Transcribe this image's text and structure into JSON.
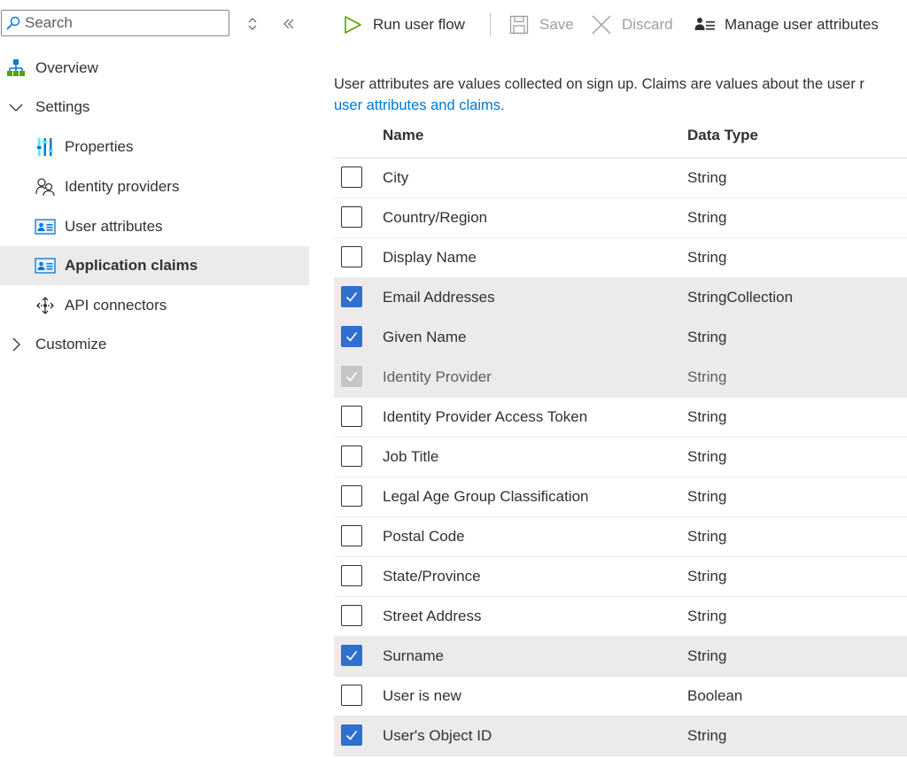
{
  "sidebar": {
    "search": {
      "placeholder": "Search",
      "value": ""
    },
    "items": [
      {
        "label": "Overview",
        "icon": "overview-icon"
      },
      {
        "label": "Settings",
        "icon": "chevron-down-icon"
      },
      {
        "label": "Properties",
        "icon": "properties-icon"
      },
      {
        "label": "Identity providers",
        "icon": "identity-providers-icon"
      },
      {
        "label": "User attributes",
        "icon": "user-attributes-icon"
      },
      {
        "label": "Application claims",
        "icon": "application-claims-icon"
      },
      {
        "label": "API connectors",
        "icon": "api-connectors-icon"
      },
      {
        "label": "Customize",
        "icon": "chevron-right-icon"
      }
    ],
    "selected": "Application claims"
  },
  "toolbar": {
    "run_label": "Run user flow",
    "save_label": "Save",
    "discard_label": "Discard",
    "manage_label": "Manage user attributes"
  },
  "description": {
    "text": "User attributes are values collected on sign up. Claims are values about the user r",
    "link": "user attributes and claims."
  },
  "table": {
    "headers": {
      "name": "Name",
      "type": "Data Type"
    },
    "rows": [
      {
        "name": "City",
        "type": "String",
        "checked": false,
        "disabled": false
      },
      {
        "name": "Country/Region",
        "type": "String",
        "checked": false,
        "disabled": false
      },
      {
        "name": "Display Name",
        "type": "String",
        "checked": false,
        "disabled": false
      },
      {
        "name": "Email Addresses",
        "type": "StringCollection",
        "checked": true,
        "disabled": false
      },
      {
        "name": "Given Name",
        "type": "String",
        "checked": true,
        "disabled": false
      },
      {
        "name": "Identity Provider",
        "type": "String",
        "checked": true,
        "disabled": true
      },
      {
        "name": "Identity Provider Access Token",
        "type": "String",
        "checked": false,
        "disabled": false
      },
      {
        "name": "Job Title",
        "type": "String",
        "checked": false,
        "disabled": false
      },
      {
        "name": "Legal Age Group Classification",
        "type": "String",
        "checked": false,
        "disabled": false
      },
      {
        "name": "Postal Code",
        "type": "String",
        "checked": false,
        "disabled": false
      },
      {
        "name": "State/Province",
        "type": "String",
        "checked": false,
        "disabled": false
      },
      {
        "name": "Street Address",
        "type": "String",
        "checked": false,
        "disabled": false
      },
      {
        "name": "Surname",
        "type": "String",
        "checked": true,
        "disabled": false
      },
      {
        "name": "User is new",
        "type": "Boolean",
        "checked": false,
        "disabled": false
      },
      {
        "name": "User's Object ID",
        "type": "String",
        "checked": true,
        "disabled": false
      }
    ]
  },
  "colors": {
    "accent": "#2f6fcf",
    "link": "#0078d4",
    "selected_bg": "#edebe9",
    "run_icon": "#57a300"
  }
}
